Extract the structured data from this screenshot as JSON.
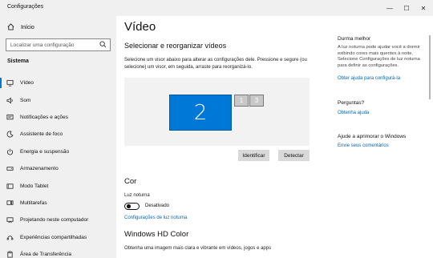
{
  "window": {
    "title": "Configurações",
    "controls": [
      "—",
      "☐",
      "✕"
    ]
  },
  "sidebar": {
    "home_label": "Início",
    "search_placeholder": "Localizar uma configuração",
    "section_title": "Sistema",
    "items": [
      {
        "label": "Vídeo",
        "icon": "monitor-icon",
        "active": true
      },
      {
        "label": "Som",
        "icon": "speaker-icon"
      },
      {
        "label": "Notificações e ações",
        "icon": "notifications-icon"
      },
      {
        "label": "Assistente de foco",
        "icon": "focus-moon-icon"
      },
      {
        "label": "Energia e suspensão",
        "icon": "power-icon"
      },
      {
        "label": "Armazenamento",
        "icon": "storage-icon"
      },
      {
        "label": "Modo Tablet",
        "icon": "tablet-icon"
      },
      {
        "label": "Multitarefas",
        "icon": "multitask-icon"
      },
      {
        "label": "Projetando neste computador",
        "icon": "projector-icon"
      },
      {
        "label": "Experiências compartilhadas",
        "icon": "shared-icon"
      },
      {
        "label": "Área de Transferência",
        "icon": "clipboard-icon"
      }
    ]
  },
  "main": {
    "title": "Vídeo",
    "subtitle": "Selecionar e reorganizar vídeos",
    "description": "Selecione um visor abaixo para alterar as configurações dele. Pressione e segure (ou selecione) um visor, em seguida, arraste para reorganizá-lo.",
    "displays": [
      "2",
      "1",
      "3"
    ],
    "identify_button": "Identificar",
    "detect_button": "Detectar",
    "color_heading": "Cor",
    "night_light_label": "Luz noturna",
    "night_light_state": "Desativado",
    "night_light_link": "Configurações de luz noturna",
    "hdr_heading": "Windows HD Color",
    "hdr_desc": "Obtenha uma imagem mais clara e vibrante em vídeos, jogos e apps"
  },
  "right_panel": {
    "sleep_heading": "Durma melhor",
    "sleep_text": "A luz noturna pode ajudar você a dormir exibindo cores mais quentes à noite. Selecione Configurações de luz noturna para definir as configurações.",
    "help_link": "Obter ajuda para configurá-la",
    "questions_heading": "Perguntas?",
    "get_help_link": "Obtenha ajuda",
    "improve_heading": "Ajude a aprimorar o Windows",
    "feedback_link": "Envie seus comentários"
  }
}
